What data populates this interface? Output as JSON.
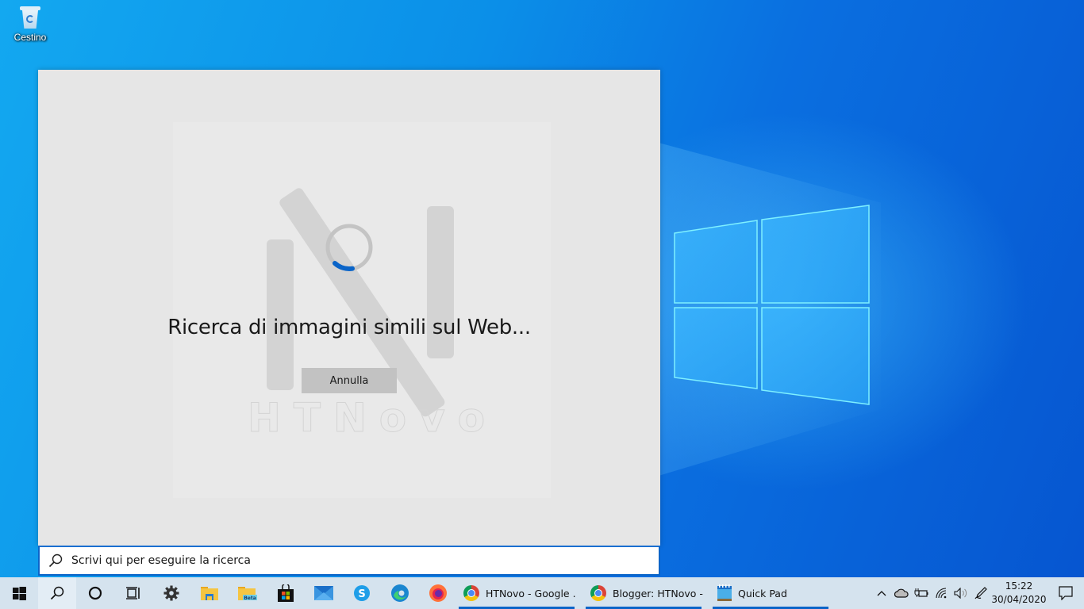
{
  "desktop": {
    "icons": [
      {
        "label": "Cestino",
        "icon": "recycle-bin-icon"
      }
    ],
    "wallpaper": "windows-10-logo"
  },
  "search_panel": {
    "status_text": "Ricerca di immagini simili sul Web...",
    "cancel_label": "Annulla",
    "watermark_text": "HTNovo",
    "spinner_color": "#0a64c8"
  },
  "search_box": {
    "placeholder": "Scrivi qui per eseguire la ricerca",
    "value": ""
  },
  "taskbar": {
    "pinned": [
      {
        "name": "start",
        "icon": "windows-start-icon"
      },
      {
        "name": "search",
        "icon": "search-icon",
        "active": true
      },
      {
        "name": "cortana",
        "icon": "cortana-circle-icon"
      },
      {
        "name": "task-view",
        "icon": "task-view-icon"
      },
      {
        "name": "settings",
        "icon": "gear-icon"
      },
      {
        "name": "file-explorer",
        "icon": "folder-icon"
      },
      {
        "name": "file-explorer-beta",
        "icon": "folder-beta-icon",
        "badge": "Beta"
      },
      {
        "name": "store",
        "icon": "store-bag-icon"
      },
      {
        "name": "mail",
        "icon": "mail-icon"
      },
      {
        "name": "skype",
        "icon": "skype-icon"
      },
      {
        "name": "edge",
        "icon": "edge-icon"
      },
      {
        "name": "firefox",
        "icon": "firefox-icon"
      }
    ],
    "apps": [
      {
        "title": "HTNovo - Google ...",
        "icon": "chrome-icon"
      },
      {
        "title": "Blogger: HTNovo - ...",
        "icon": "chrome-icon"
      },
      {
        "title": "Quick Pad",
        "icon": "quickpad-icon"
      }
    ],
    "tray": {
      "icons": [
        "chevron-up-icon",
        "onedrive-cloud-icon",
        "battery-plug-icon",
        "wifi-icon",
        "volume-icon",
        "pen-icon"
      ],
      "time": "15:22",
      "date": "30/04/2020",
      "notification_icon": "action-center-icon"
    },
    "accent": "#0a64c8"
  }
}
